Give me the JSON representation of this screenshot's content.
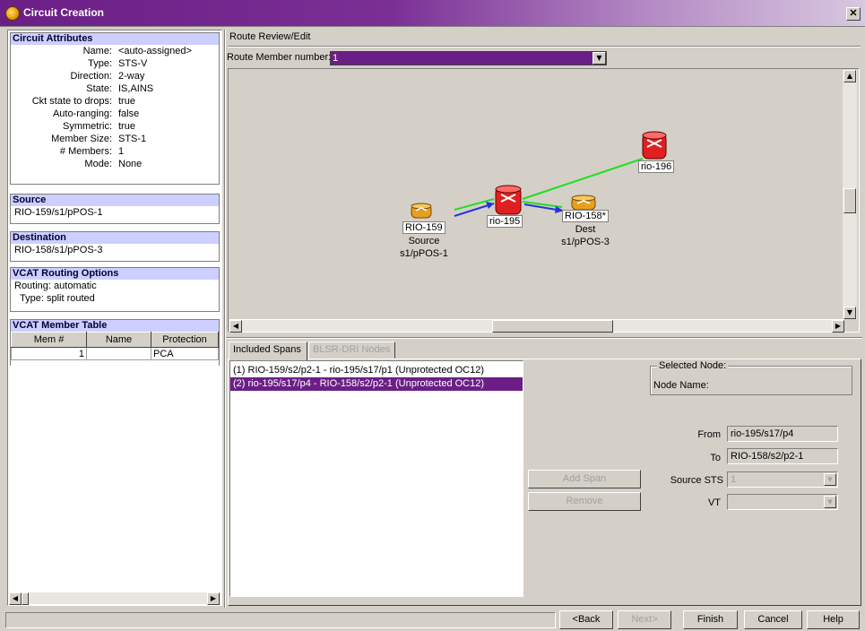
{
  "window": {
    "title": "Circuit Creation",
    "close_glyph": "✕"
  },
  "circuit_attributes": {
    "header": "Circuit Attributes",
    "rows": [
      {
        "key": "Name:",
        "value": "<auto-assigned>"
      },
      {
        "key": "Type:",
        "value": "STS-V"
      },
      {
        "key": "Direction:",
        "value": "2-way"
      },
      {
        "key": "State:",
        "value": "IS,AINS"
      },
      {
        "key": "Ckt state to drops:",
        "value": "true"
      },
      {
        "key": "Auto-ranging:",
        "value": "false"
      },
      {
        "key": "Symmetric:",
        "value": "true"
      },
      {
        "key": "Member Size:",
        "value": "STS-1"
      },
      {
        "key": "# Members:",
        "value": "1"
      },
      {
        "key": "Mode:",
        "value": "None"
      }
    ]
  },
  "source": {
    "header": "Source",
    "value": "RIO-159/s1/pPOS-1"
  },
  "destination": {
    "header": "Destination",
    "value": "RIO-158/s1/pPOS-3"
  },
  "vcat_routing": {
    "header": "VCAT Routing Options",
    "routing_key": "Routing:",
    "routing_value": "automatic",
    "type_key": "Type:",
    "type_value": "split routed"
  },
  "vcat_member_table": {
    "header": "VCAT Member Table",
    "columns": [
      "Mem #",
      "Name",
      "Protection"
    ],
    "rows": [
      {
        "mem": "1",
        "name": "",
        "protection": "PCA"
      }
    ]
  },
  "route_review": {
    "label": "Route Review/Edit",
    "member_number_label": "Route Member number:",
    "member_number_value": "1"
  },
  "graph": {
    "nodes": {
      "rio159": {
        "label": "RIO-159",
        "line2": "Source",
        "line3": "s1/pPOS-1",
        "color": "#e6a020"
      },
      "rio195": {
        "label": "rio-195",
        "color": "#e02020"
      },
      "rio158": {
        "label": "RIO-158*",
        "line2": "Dest",
        "line3": "s1/pPOS-3",
        "color": "#e6a020"
      },
      "rio196": {
        "label": "rio-196",
        "color": "#e02020"
      }
    },
    "colors": {
      "green_link": "#22dd22",
      "blue_link": "#2233dd"
    }
  },
  "tabs": {
    "included_spans": "Included Spans",
    "blsr_dri": "BLSR-DRI Nodes"
  },
  "spans": [
    {
      "text": "(1) RIO-159/s2/p2-1 - rio-195/s17/p1 (Unprotected OC12)",
      "selected": false
    },
    {
      "text": "(2) rio-195/s17/p4 - RIO-158/s2/p2-1 (Unprotected OC12)",
      "selected": true
    }
  ],
  "selected_node": {
    "legend": "Selected Node:",
    "name_label": "Node Name:"
  },
  "span_buttons": {
    "add": "Add Span",
    "remove": "Remove"
  },
  "fields": {
    "from_label": "From",
    "from_value": "rio-195/s17/p4",
    "to_label": "To",
    "to_value": "RIO-158/s2/p2-1",
    "source_sts_label": "Source STS",
    "source_sts_value": "1",
    "vt_label": "VT",
    "vt_value": ""
  },
  "footer": {
    "back": "<Back",
    "next": "Next>",
    "finish": "Finish",
    "cancel": "Cancel",
    "help": "Help"
  },
  "accent": "#6b1f86"
}
